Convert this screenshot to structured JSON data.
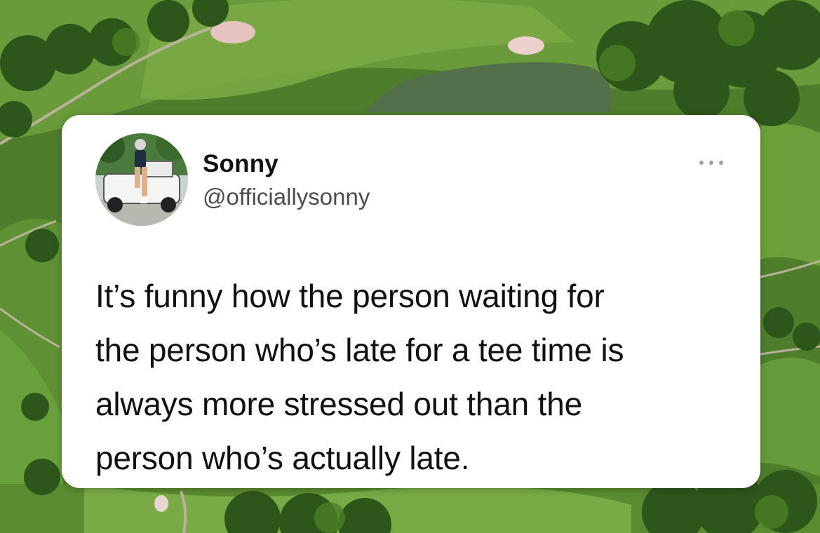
{
  "background": {
    "scene": "golf-course-aerial",
    "colors": {
      "fairway": "#6a9a3a",
      "rough": "#3f6b22",
      "trees": "#2f5418",
      "water": "#4f6d3e",
      "sand": "#e7c7c4"
    }
  },
  "tweet": {
    "display_name": "Sonny",
    "handle": "@officiallysonny",
    "more_icon": "ellipsis-icon",
    "avatar_icon": "profile-photo-golf-cart",
    "text_lines": [
      "It’s funny how the person waiting for",
      "the person who’s late for a tee time is",
      "always more stressed out than the",
      "person who’s actually late."
    ]
  }
}
